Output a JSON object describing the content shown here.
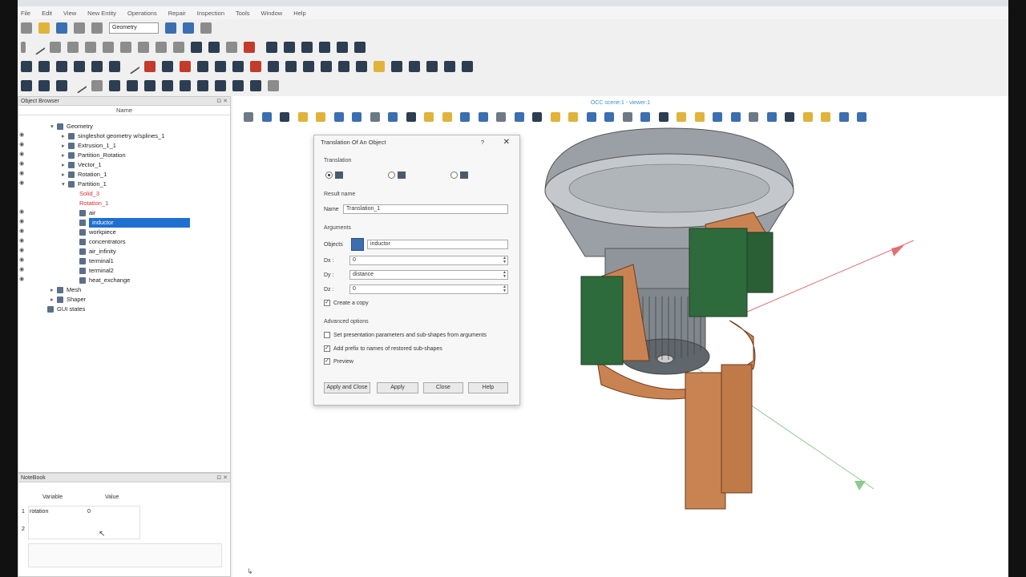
{
  "menu": [
    "File",
    "Edit",
    "View",
    "New Entity",
    "Operations",
    "Repair",
    "Inspection",
    "Tools",
    "Window",
    "Help"
  ],
  "toolbar": {
    "module_combo": "Geometry"
  },
  "object_browser": {
    "title": "Object Browser",
    "column": "Name",
    "items": [
      {
        "label": "Geometry",
        "level": 1
      },
      {
        "label": "singleshot geometry w/splines_1",
        "level": 2
      },
      {
        "label": "Extrusion_1_1",
        "level": 2
      },
      {
        "label": "Partition_Rotation",
        "level": 2
      },
      {
        "label": "Vector_1",
        "level": 2
      },
      {
        "label": "Rotation_1",
        "level": 2
      },
      {
        "label": "Partition_1",
        "level": 2
      },
      {
        "label": "Solid_3",
        "level": 3
      },
      {
        "label": "Rotation_1",
        "level": 3
      },
      {
        "label": "air",
        "level": 3
      },
      {
        "label": "inductor",
        "level": 3
      },
      {
        "label": "workpiece",
        "level": 3
      },
      {
        "label": "concentrators",
        "level": 3
      },
      {
        "label": "air_infinity",
        "level": 3
      },
      {
        "label": "terminal1",
        "level": 3
      },
      {
        "label": "terminal2",
        "level": 3
      },
      {
        "label": "heat_exchange",
        "level": 3
      },
      {
        "label": "Mesh",
        "level": 1
      },
      {
        "label": "Shaper",
        "level": 1
      },
      {
        "label": "GUI states",
        "level": 0
      }
    ]
  },
  "notebook": {
    "title": "NoteBook",
    "headers": [
      "Variable",
      "Value"
    ],
    "rows": [
      {
        "num": "1",
        "variable": "rotation",
        "value": "0"
      },
      {
        "num": "2",
        "variable": "",
        "value": ""
      }
    ]
  },
  "viewer": {
    "title": "OCC scene:1 - viewer:1"
  },
  "dialog": {
    "title": "Translation Of An Object",
    "help_glyph": "?",
    "close_glyph": "✕",
    "translation_label": "Translation",
    "result_name_label": "Result name",
    "name_label": "Name",
    "name_value": "Translation_1",
    "arguments_label": "Arguments",
    "objects_label": "Objects",
    "objects_value": "inductor",
    "dx_label": "Dx :",
    "dx_value": "0",
    "dy_label": "Dy :",
    "dy_value": "distance",
    "dz_label": "Dz :",
    "dz_value": "0",
    "create_copy": "Create a copy",
    "advanced_label": "Advanced options",
    "opt_set_params": "Set presentation parameters and sub-shapes from arguments",
    "opt_add_prefix": "Add prefix to names of restored sub-shapes",
    "opt_preview": "Preview",
    "btn_apply_close": "Apply and Close",
    "btn_apply": "Apply",
    "btn_close": "Close",
    "btn_help": "Help"
  }
}
